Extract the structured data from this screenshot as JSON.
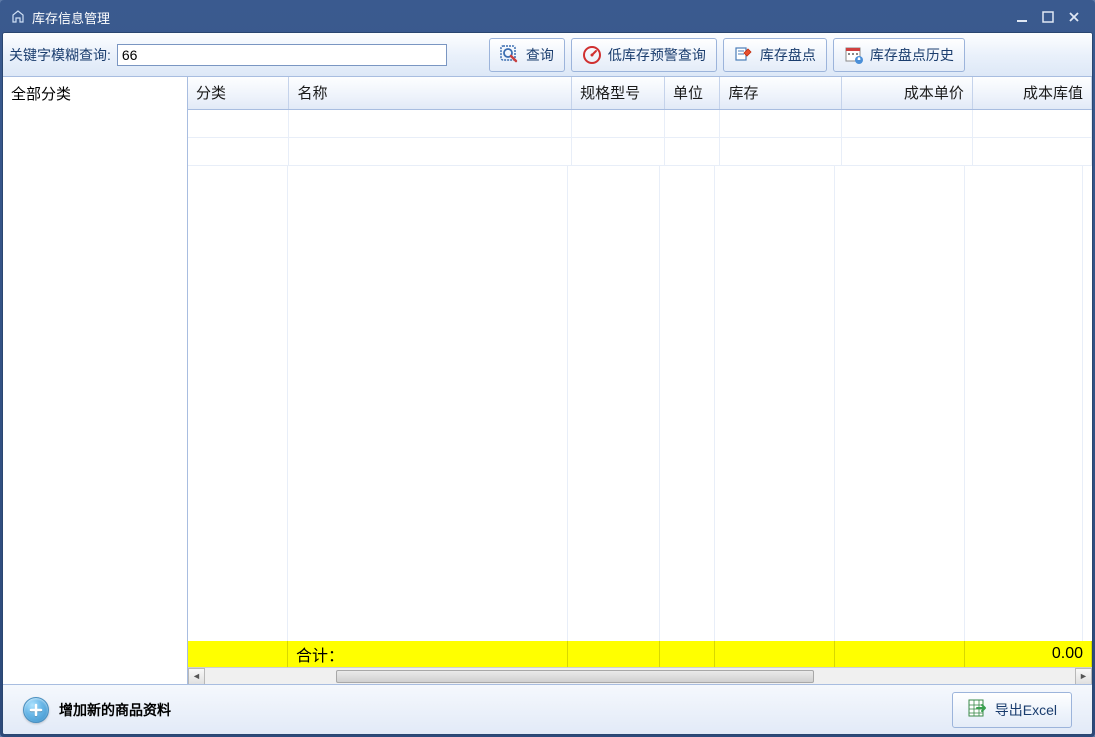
{
  "window": {
    "title": "库存信息管理"
  },
  "toolbar": {
    "search_label": "关键字模糊查询:",
    "search_value": "66",
    "query_button": "查询",
    "low_stock_button": "低库存预警查询",
    "stock_count_button": "库存盘点",
    "stock_history_button": "库存盘点历史"
  },
  "sidebar": {
    "all_categories": "全部分类"
  },
  "table": {
    "columns": {
      "category": "分类",
      "name": "名称",
      "spec": "规格型号",
      "unit": "单位",
      "stock": "库存",
      "cost_price": "成本单价",
      "cost_value": "成本库值"
    },
    "summary_label": "合计：",
    "summary_total": "0.00"
  },
  "bottom": {
    "add_product": "增加新的商品资料",
    "export_excel": "导出Excel"
  }
}
